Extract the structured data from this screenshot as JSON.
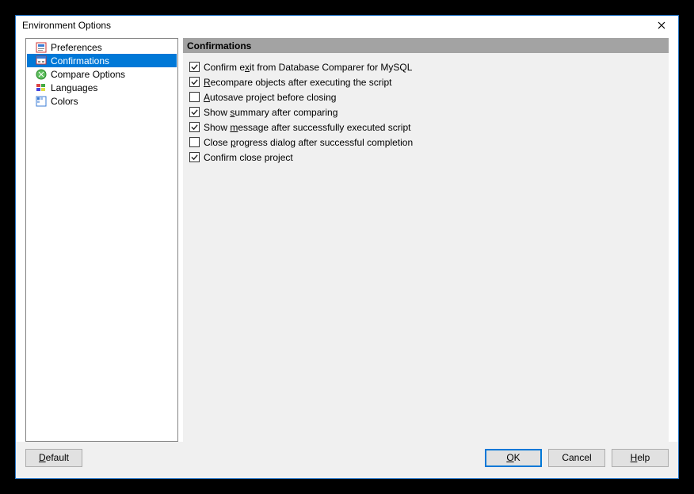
{
  "window": {
    "title": "Environment Options"
  },
  "sidebar": {
    "items": [
      {
        "label": "Preferences",
        "icon": "preferences"
      },
      {
        "label": "Confirmations",
        "icon": "confirmations",
        "selected": true
      },
      {
        "label": "Compare Options",
        "icon": "compare"
      },
      {
        "label": "Languages",
        "icon": "languages"
      },
      {
        "label": "Colors",
        "icon": "colors"
      }
    ]
  },
  "main": {
    "section_title": "Confirmations",
    "options": [
      {
        "label_pre": "Confirm e",
        "accel": "x",
        "label_post": "it from Database Comparer for MySQL",
        "checked": true
      },
      {
        "label_pre": "",
        "accel": "R",
        "label_post": "ecompare objects after executing the script",
        "checked": true
      },
      {
        "label_pre": "",
        "accel": "A",
        "label_post": "utosave project before closing",
        "checked": false
      },
      {
        "label_pre": "Show ",
        "accel": "s",
        "label_post": "ummary after comparing",
        "checked": true
      },
      {
        "label_pre": "Show ",
        "accel": "m",
        "label_post": "essage after successfully executed script",
        "checked": true
      },
      {
        "label_pre": "Close ",
        "accel": "p",
        "label_post": "rogress dialog after successful completion",
        "checked": false
      },
      {
        "label_pre": "Confirm close pro",
        "accel": "j",
        "label_post": "ect",
        "checked": true
      }
    ]
  },
  "footer": {
    "default_label_pre": "",
    "default_accel": "D",
    "default_label_post": "efault",
    "ok_label_pre": "",
    "ok_accel": "O",
    "ok_label_post": "K",
    "cancel_label": "Cancel",
    "help_label_pre": "",
    "help_accel": "H",
    "help_label_post": "elp"
  }
}
